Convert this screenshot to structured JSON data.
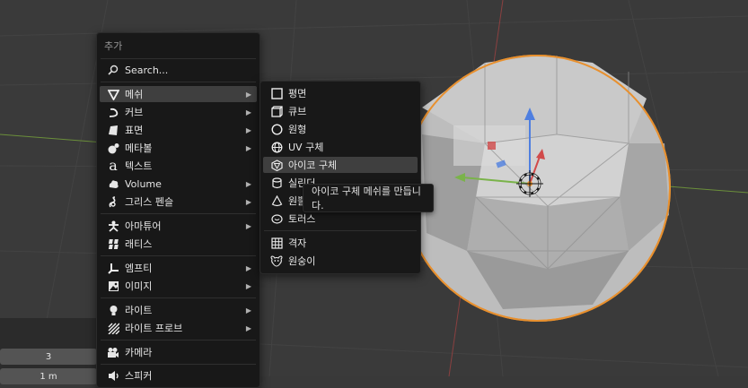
{
  "viewport": {
    "accent_color": "#e8902e"
  },
  "add_menu": {
    "title": "추가",
    "search": {
      "label": "Search...",
      "icon": "search-icon"
    },
    "items": [
      {
        "label": "메쉬",
        "icon": "mesh-icon",
        "submenu": true,
        "active": true
      },
      {
        "label": "커브",
        "icon": "curve-icon",
        "submenu": true
      },
      {
        "label": "표면",
        "icon": "surface-icon",
        "submenu": true
      },
      {
        "label": "메타볼",
        "icon": "metaball-icon",
        "submenu": true
      },
      {
        "label": "텍스트",
        "icon": "text-icon",
        "submenu": false
      },
      {
        "label": "Volume",
        "icon": "volume-icon",
        "submenu": true
      },
      {
        "label": "그리스 펜슬",
        "icon": "grease-pencil-icon",
        "submenu": true
      },
      {
        "label": "아마튜어",
        "icon": "armature-icon",
        "submenu": true
      },
      {
        "label": "래티스",
        "icon": "lattice-icon",
        "submenu": false
      },
      {
        "label": "엠프티",
        "icon": "empty-icon",
        "submenu": true
      },
      {
        "label": "이미지",
        "icon": "image-icon",
        "submenu": true
      },
      {
        "label": "라이트",
        "icon": "light-icon",
        "submenu": true
      },
      {
        "label": "라이트 프로브",
        "icon": "light-probe-icon",
        "submenu": true
      },
      {
        "label": "카메라",
        "icon": "camera-icon",
        "submenu": false
      },
      {
        "label": "스피커",
        "icon": "speaker-icon",
        "submenu": false
      }
    ]
  },
  "mesh_submenu": {
    "items": [
      {
        "label": "평면",
        "icon": "plane-icon"
      },
      {
        "label": "큐브",
        "icon": "cube-icon"
      },
      {
        "label": "원형",
        "icon": "circle-icon"
      },
      {
        "label": "UV 구체",
        "icon": "uv-sphere-icon"
      },
      {
        "label": "아이코 구체",
        "icon": "ico-sphere-icon",
        "active": true
      },
      {
        "label": "실린더",
        "icon": "cylinder-icon"
      },
      {
        "label": "원뿔",
        "icon": "cone-icon"
      },
      {
        "label": "토러스",
        "icon": "torus-icon"
      },
      {
        "label": "격자",
        "icon": "grid-icon"
      },
      {
        "label": "원숭이",
        "icon": "monkey-icon"
      }
    ]
  },
  "tooltip": {
    "text": "아이코 구체 메쉬를 만듭니다."
  },
  "bottom_panel": {
    "field_1": "3",
    "field_2": "1 m"
  }
}
